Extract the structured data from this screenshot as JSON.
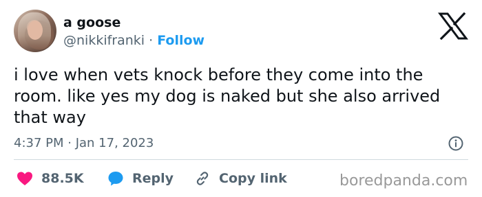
{
  "author": {
    "display_name": "a goose",
    "handle": "@nikkifranki",
    "separator": " · ",
    "follow_label": "Follow"
  },
  "tweet": {
    "text": "i love when vets knock before they come into the room. like yes my dog is naked but she also arrived that way",
    "timestamp": "4:37 PM · Jan 17, 2023"
  },
  "actions": {
    "like_count": "88.5K",
    "reply_label": "Reply",
    "copy_link_label": "Copy link"
  },
  "watermark": "boredpanda.com",
  "colors": {
    "accent": "#1d9bf0",
    "like": "#f91880",
    "text": "#0f1419",
    "muted": "#536471"
  },
  "icons": [
    "x-logo",
    "heart-icon",
    "reply-bubble-icon",
    "link-icon",
    "info-icon"
  ]
}
